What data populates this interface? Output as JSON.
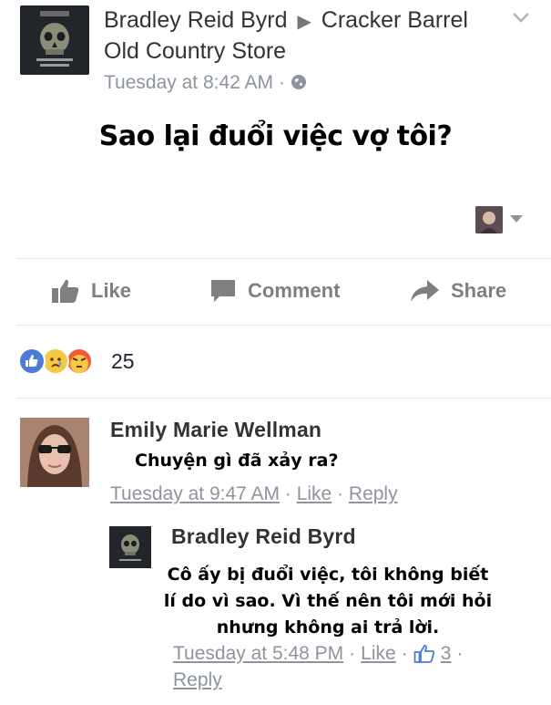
{
  "post": {
    "author": "Bradley Reid Byrd",
    "arrow": "▶",
    "target_page": "Cracker Barrel Old Country Store",
    "timestamp": "Tuesday at 8:42 AM",
    "separator": "·",
    "text": "Sao lại đuổi việc vợ tôi?"
  },
  "actions": {
    "like_label": "Like",
    "comment_label": "Comment",
    "share_label": "Share"
  },
  "reactions": {
    "icons": [
      "like-reaction-icon",
      "sad-reaction-icon",
      "angry-reaction-icon"
    ],
    "count": "25"
  },
  "comments": [
    {
      "author": "Emily Marie Wellman",
      "text": "Chuyện gì đã xảy ra?",
      "timestamp": "Tuesday at 9:47 AM",
      "like_label": "Like",
      "reply_label": "Reply"
    },
    {
      "author": "Bradley Reid Byrd",
      "text_line1": "Cô ấy bị đuổi việc, tôi không biết",
      "text_line2": "lí do vì sao. Vì thế nên tôi mới hỏi",
      "text_line3": "nhưng không ai trả lời.",
      "timestamp": "Tuesday at 5:48 PM",
      "like_label": "Like",
      "like_count": "3",
      "reply_label": "Reply"
    }
  ],
  "colors": {
    "meta_gray": "#8d949e",
    "like_blue": "#4c7cd6",
    "reaction_yellow": "#f7c843",
    "angry_red": "#f05a3a"
  }
}
